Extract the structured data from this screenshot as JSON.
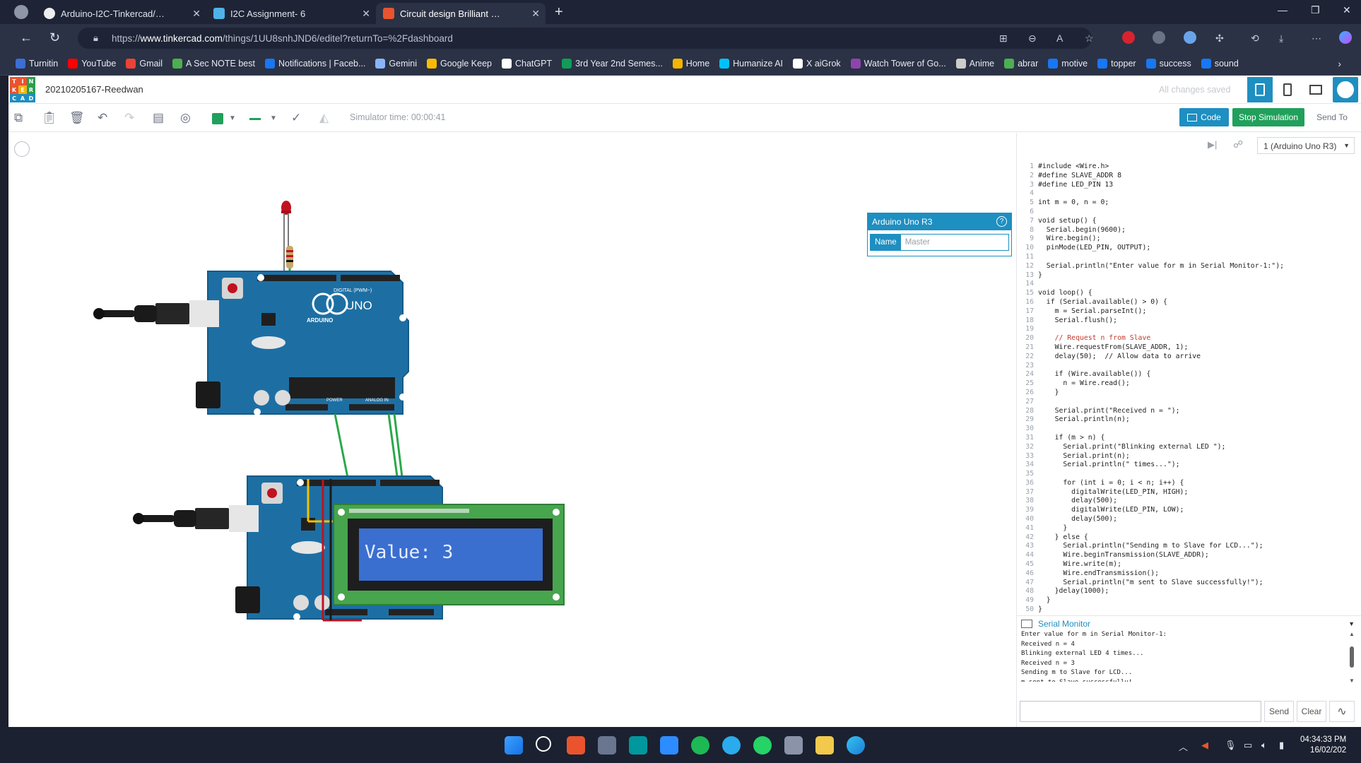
{
  "browser": {
    "tabs": [
      {
        "title": "Arduino-I2C-Tinkercad/Soln-1: Co",
        "icon": "github-icon"
      },
      {
        "title": "I2C Assignment- 6",
        "icon": "doc-icon"
      },
      {
        "title": "Circuit design Brilliant Curcan - Ti",
        "icon": "tinkercad-icon"
      }
    ],
    "url_prefix": "https://",
    "url_host": "www.tinkercad.com",
    "url_path": "/things/1UU8snhJND6/editel?returnTo=%2Fdashboard",
    "bookmarks": [
      "Turnitin",
      "YouTube",
      "Gmail",
      "A Sec NOTE best",
      "Notifications | Faceb...",
      "Gemini",
      "Google Keep",
      "ChatGPT",
      "3rd Year 2nd Semes...",
      "Home",
      "Humanize AI",
      "X aiGrok",
      "Watch Tower of Go...",
      "Anime",
      "abrar",
      "motive",
      "topper",
      "success",
      "sound"
    ]
  },
  "app": {
    "logo_letters": [
      "T",
      "I",
      "N",
      "K",
      "E",
      "R",
      "C",
      "A",
      "D"
    ],
    "project_name": "20210205167-Reedwan",
    "saved_status": "All changes saved",
    "sim_time": "Simulator time: 00:00:41",
    "code_button": "Code",
    "stop_button": "Stop Simulation",
    "send_to_button": "Send To"
  },
  "inspector": {
    "title": "Arduino Uno R3",
    "help": "?",
    "name_label": "Name",
    "name_value": "Master"
  },
  "board_labels": {
    "uno": "UNO",
    "arduino": "ARDUINO",
    "digital": "DIGITAL (PWM~)",
    "power": "POWER",
    "analog": "ANALOG IN"
  },
  "lcd_text": "Value: 3",
  "code_panel": {
    "device": "1 (Arduino Uno R3)",
    "lines": [
      "#include <Wire.h>",
      "#define SLAVE_ADDR 8",
      "#define LED_PIN 13",
      "",
      "int m = 0, n = 0;",
      "",
      "void setup() {",
      "  Serial.begin(9600);",
      "  Wire.begin();",
      "  pinMode(LED_PIN, OUTPUT);",
      "",
      "  Serial.println(\"Enter value for m in Serial Monitor-1:\");",
      "}",
      "",
      "void loop() {",
      "  if (Serial.available() > 0) {",
      "    m = Serial.parseInt();",
      "    Serial.flush();",
      "",
      "    // Request n from Slave",
      "    Wire.requestFrom(SLAVE_ADDR, 1);",
      "    delay(50);  // Allow data to arrive",
      "",
      "    if (Wire.available()) {",
      "      n = Wire.read();",
      "    }",
      "",
      "    Serial.print(\"Received n = \");",
      "    Serial.println(n);",
      "",
      "    if (m > n) {",
      "      Serial.print(\"Blinking external LED \");",
      "      Serial.print(n);",
      "      Serial.println(\" times...\");",
      "",
      "      for (int i = 0; i < n; i++) {",
      "        digitalWrite(LED_PIN, HIGH);",
      "        delay(500);",
      "        digitalWrite(LED_PIN, LOW);",
      "        delay(500);",
      "      }",
      "    } else {",
      "      Serial.println(\"Sending m to Slave for LCD...\");",
      "      Wire.beginTransmission(SLAVE_ADDR);",
      "      Wire.write(m);",
      "      Wire.endTransmission();",
      "      Serial.println(\"m sent to Slave successfully!\");",
      "    }delay(1000);",
      "  }",
      "}"
    ],
    "serial_monitor_title": "Serial Monitor",
    "serial_output": [
      "Enter value for m in Serial Monitor-1:",
      "Received n = 4",
      "Blinking external LED 4 times...",
      "Received n = 3",
      "Sending m to Slave for LCD...",
      "m sent to Slave successfully!"
    ],
    "send_button": "Send",
    "clear_button": "Clear"
  },
  "taskbar": {
    "time": "04:34:33 PM",
    "date": "16/02/202"
  },
  "colors": {
    "accent": "#1e8fc1",
    "stop_green": "#21a05b",
    "board_blue": "#1d6fa3",
    "lcd_blue": "#3a6fd0"
  }
}
